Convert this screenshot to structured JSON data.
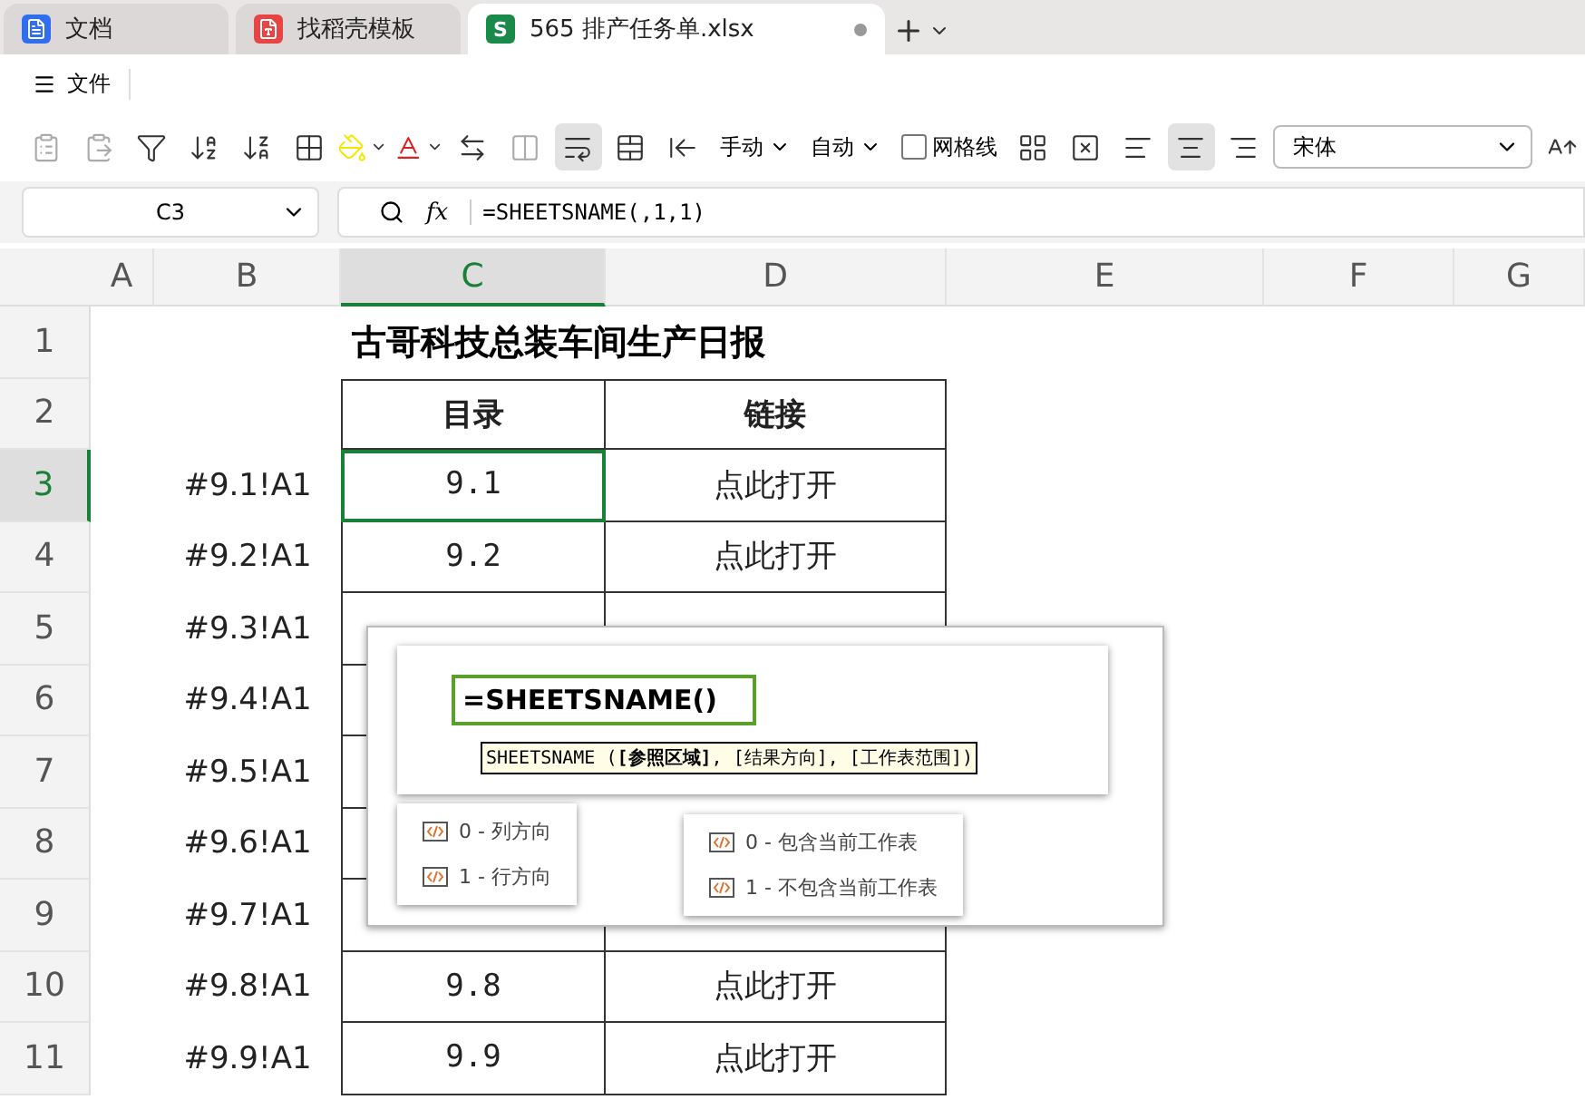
{
  "tabs": [
    {
      "kind": "doc",
      "label": "文档",
      "selected": false
    },
    {
      "kind": "template",
      "label": "找稻壳模板",
      "selected": false
    },
    {
      "kind": "sheet",
      "badge": "S",
      "label": "565 排产任务单.xlsx",
      "selected": true
    }
  ],
  "menu": {
    "label": "文件"
  },
  "toolbar": [
    {
      "kind": "paste-values",
      "disabled": true,
      "selected": false
    },
    {
      "kind": "paste-format",
      "disabled": true,
      "selected": false
    },
    {
      "kind": "filter",
      "disabled": false,
      "selected": false
    },
    {
      "kind": "sort-asc",
      "disabled": false,
      "selected": false
    },
    {
      "kind": "sort-desc",
      "disabled": false,
      "selected": false
    },
    {
      "kind": "borders",
      "disabled": false,
      "selected": false
    },
    {
      "kind": "fill-color",
      "color": "#f5e600",
      "disabled": false,
      "selected": false
    },
    {
      "kind": "font-color",
      "color": "#e02020",
      "disabled": false,
      "selected": false
    },
    {
      "kind": "convert",
      "disabled": false,
      "selected": false
    },
    {
      "kind": "split",
      "disabled": true,
      "selected": false
    },
    {
      "kind": "wrap",
      "disabled": false,
      "selected": true
    },
    {
      "kind": "merge",
      "disabled": false,
      "selected": false
    },
    {
      "kind": "fill-left",
      "disabled": false,
      "selected": false
    },
    {
      "kind": "dropdown",
      "label": "手动"
    },
    {
      "kind": "dropdown",
      "label": "自动"
    },
    {
      "kind": "checkbox",
      "label": "网格线",
      "checked": false
    },
    {
      "kind": "cond-format",
      "disabled": false,
      "selected": false
    },
    {
      "kind": "clear-format",
      "disabled": false,
      "selected": false
    },
    {
      "kind": "align-left",
      "disabled": false,
      "selected": false
    },
    {
      "kind": "align-center",
      "disabled": false,
      "selected": true
    },
    {
      "kind": "align-right",
      "disabled": false,
      "selected": false
    },
    {
      "kind": "font-select",
      "label": "宋体"
    },
    {
      "kind": "font-grow",
      "disabled": false,
      "selected": false
    }
  ],
  "formula_bar": {
    "cell": "C3",
    "fx_label": "fx",
    "formula": "=SHEETSNAME(,1,1)"
  },
  "columns": [
    {
      "label": "A",
      "selected": false
    },
    {
      "label": "B",
      "selected": false
    },
    {
      "label": "C",
      "selected": true
    },
    {
      "label": "D",
      "selected": false
    },
    {
      "label": "E",
      "selected": false
    },
    {
      "label": "F",
      "selected": false
    },
    {
      "label": "G",
      "selected": false
    }
  ],
  "title": {
    "row": "1",
    "text": "古哥科技总装车间生产日报"
  },
  "header_row": {
    "row": "2",
    "cells": [
      "目录",
      "链接"
    ]
  },
  "rows": [
    {
      "row": "3",
      "selected": true,
      "b": "#9.1!A1",
      "c": "9.1",
      "d": "点此打开"
    },
    {
      "row": "4",
      "selected": false,
      "b": "#9.2!A1",
      "c": "9.2",
      "d": "点此打开"
    },
    {
      "row": "5",
      "selected": false,
      "b": "#9.3!A1"
    },
    {
      "row": "6",
      "selected": false,
      "b": "#9.4!A1"
    },
    {
      "row": "7",
      "selected": false,
      "b": "#9.5!A1"
    },
    {
      "row": "8",
      "selected": false,
      "b": "#9.6!A1"
    },
    {
      "row": "9",
      "selected": false,
      "b": "#9.7!A1"
    },
    {
      "row": "10",
      "selected": false,
      "b": "#9.8!A1",
      "c": "9.8",
      "d": "点此打开"
    },
    {
      "row": "11",
      "selected": false,
      "b": "#9.9!A1",
      "c": "9.9",
      "d": "点此打开"
    }
  ],
  "overlay": {
    "formula": "=SHEETSNAME()",
    "hint": "SHEETSNAME (**[参照区域]**, [结果方向], [工作表范围])",
    "option_groups": [
      [
        "0 - 列方向",
        "1 - 行方向"
      ],
      [
        "0 - 包含当前工作表",
        "1 - 不包含当前工作表"
      ]
    ]
  }
}
